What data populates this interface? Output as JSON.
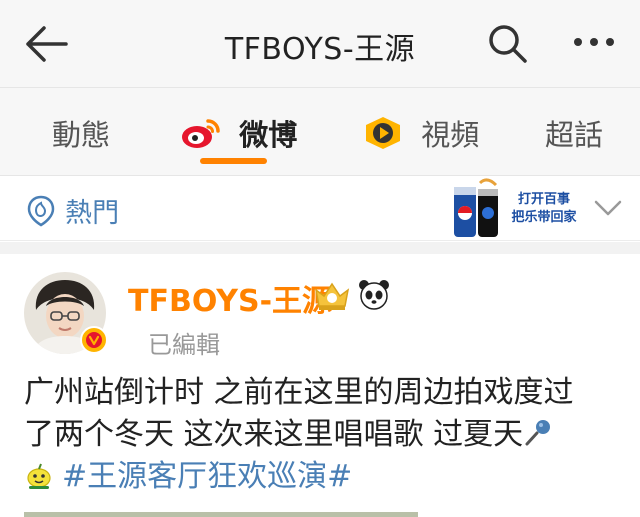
{
  "header": {
    "title": "TFBOYS-王源",
    "back_icon": "arrow-left-icon",
    "search_icon": "search-icon",
    "more_icon": "more-icon"
  },
  "tabs": [
    {
      "label": "動態",
      "active": false
    },
    {
      "label": "微博",
      "active": true,
      "icon": "weibo-logo-icon"
    },
    {
      "label": "視頻",
      "active": false,
      "icon": "video-play-icon"
    },
    {
      "label": "超話",
      "active": false
    }
  ],
  "hotbar": {
    "label": "熱門",
    "icon": "hot-location-icon",
    "ad_text": [
      "打开百事",
      "把乐带回家"
    ],
    "chevron_icon": "chevron-down-icon"
  },
  "post": {
    "author": "TFBOYS-王源",
    "edited": "已編輯",
    "lines": [
      "广州站倒计时  之前在这里的周边拍戏度过",
      "了两个冬天 这次来这里唱唱歌 过夏天"
    ],
    "hashtag": "#王源客厅狂欢巡演#"
  },
  "colors": {
    "accent": "#ff8200",
    "link": "#4a7fb5",
    "background": "#ffffff",
    "bar": "#f7f7f7"
  }
}
